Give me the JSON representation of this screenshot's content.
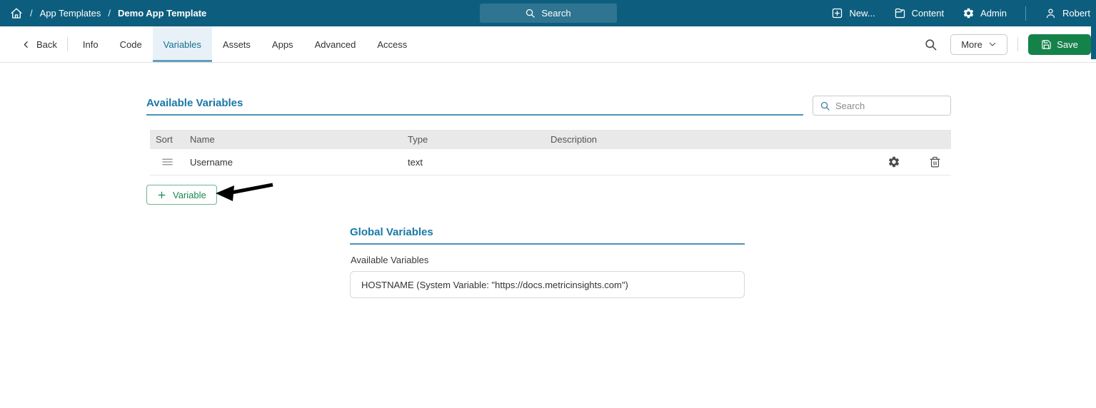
{
  "topbar": {
    "breadcrumb": {
      "separator": "/",
      "items": [
        "App Templates",
        "Demo App Template"
      ]
    },
    "search_label": "Search",
    "nav": [
      {
        "label": "New..."
      },
      {
        "label": "Content"
      },
      {
        "label": "Admin"
      },
      {
        "label": "Robert"
      }
    ]
  },
  "toolbar": {
    "back_label": "Back",
    "tabs": [
      {
        "label": "Info"
      },
      {
        "label": "Code"
      },
      {
        "label": "Variables",
        "active": true
      },
      {
        "label": "Assets"
      },
      {
        "label": "Apps"
      },
      {
        "label": "Advanced"
      },
      {
        "label": "Access"
      }
    ],
    "more_label": "More",
    "save_label": "Save"
  },
  "variables_section": {
    "title": "Available Variables",
    "search_placeholder": "Search",
    "table": {
      "columns": [
        "Sort",
        "Name",
        "Type",
        "Description"
      ],
      "rows": [
        {
          "name": "Username",
          "type": "text",
          "description": ""
        }
      ]
    },
    "add_button_label": "Variable"
  },
  "global_section": {
    "title": "Global Variables",
    "field_label": "Available Variables",
    "field_value": "HOSTNAME (System Variable: \"https://docs.metricinsights.com\")"
  },
  "colors": {
    "topbar_bg": "#0d5e7e",
    "heading_blue": "#1879a6",
    "heading_underline": "#4b94b9",
    "active_tab_bg": "#e8f1f7",
    "active_tab_text": "#17708f",
    "active_tab_underline": "#64a0bf",
    "save_green": "#15824a",
    "add_button_green": "#178a4f",
    "table_header_bg": "#e9e9e9",
    "annotation_arrow": "#000000"
  }
}
